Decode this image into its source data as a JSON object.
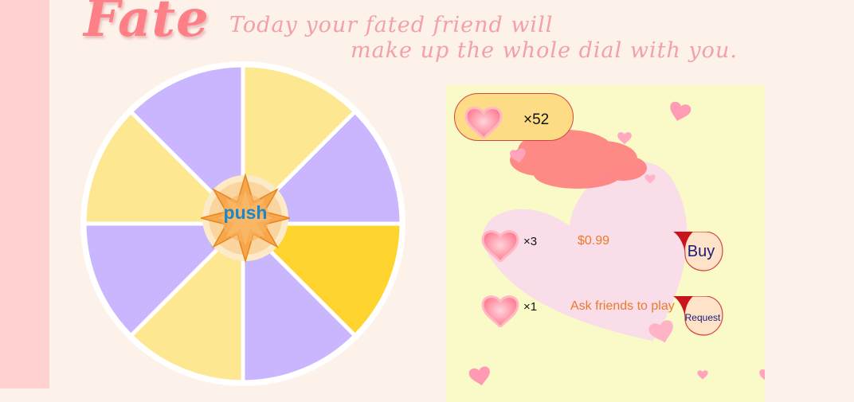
{
  "header": {
    "title": "Fate",
    "tagline_line1": "Today your fated friend will",
    "tagline_line2": "make up the whole dial with you."
  },
  "wheel": {
    "push_label": "push",
    "colors": {
      "lavender": "#c9b6ff",
      "pale_yellow": "#fde891",
      "gold": "#ffd42e"
    }
  },
  "panel": {
    "heart_counter": "×52",
    "offers": [
      {
        "qty": "×3",
        "detail": "$0.99",
        "button": "Buy"
      },
      {
        "qty": "×1",
        "detail": "Ask friends to play",
        "button": "Request"
      }
    ]
  }
}
